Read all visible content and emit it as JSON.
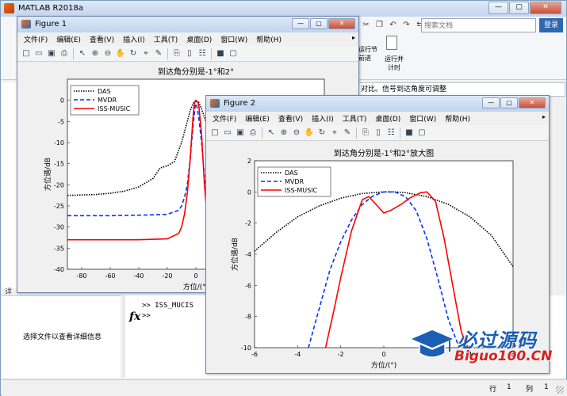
{
  "main": {
    "title": "MATLAB R2018a",
    "window_buttons": {
      "minimize": "—",
      "maximize": "▢",
      "close": "✕"
    },
    "search_placeholder": "搜索文档",
    "login_label": "登录",
    "ribbon": {
      "run_section": "运行节",
      "advance": "前进",
      "run_time": "运行并\n计时"
    },
    "address_text": "对比。信号到达角度可调整",
    "details_label": "详",
    "details_text": "选择文件以查看详细信息",
    "command_lines": [
      ">> ISS_MUCIS",
      ">>"
    ],
    "status": {
      "row_label": "行",
      "row_value": "1",
      "col_label": "列",
      "col_value": "1"
    }
  },
  "figures": [
    {
      "title": "Figure 1",
      "menu": [
        "文件(F)",
        "编辑(E)",
        "查看(V)",
        "插入(I)",
        "工具(T)",
        "桌面(D)",
        "窗口(W)",
        "帮助(H)"
      ],
      "chart_data": {
        "type": "line",
        "title": "到达角分别是-1°和2°",
        "xlabel": "方位/(°)",
        "ylabel": "方位谱/dB",
        "xlim": [
          -90,
          90
        ],
        "ylim": [
          -40,
          5
        ],
        "xticks": [
          -80,
          -60,
          -40,
          -20,
          0
        ],
        "yticks": [
          0,
          -5,
          -10,
          -15,
          -20,
          -25,
          -30,
          -35,
          -40
        ],
        "legend": "top-left",
        "series": [
          {
            "name": "DAS",
            "color": "#000000",
            "style": "dotted",
            "x": [
              -90,
              -70,
              -60,
              -50,
              -40,
              -35,
              -30,
              -25,
              -20,
              -15,
              -10,
              -8,
              -6,
              -4,
              -2,
              0,
              2,
              4,
              6,
              8,
              10,
              15
            ],
            "y": [
              -22.5,
              -22.3,
              -22,
              -21.5,
              -20.5,
              -19.5,
              -18.5,
              -16,
              -15.5,
              -14.5,
              -10,
              -7.5,
              -5,
              -2.5,
              -0.8,
              0,
              -0.5,
              -2,
              -4,
              -6,
              -8,
              -12
            ]
          },
          {
            "name": "MVDR",
            "color": "#0033ff",
            "style": "dashed",
            "x": [
              -90,
              -60,
              -40,
              -20,
              -12,
              -10,
              -8,
              -6,
              -4,
              -2,
              0,
              2,
              4,
              6,
              8,
              10
            ],
            "y": [
              -27.3,
              -27.3,
              -27.2,
              -27,
              -26,
              -25,
              -23,
              -20,
              -14,
              -6,
              0,
              -4,
              -10,
              -18,
              -24,
              -26
            ]
          },
          {
            "name": "ISS-MUSIC",
            "color": "#ff0000",
            "style": "solid",
            "x": [
              -90,
              -60,
              -40,
              -20,
              -12,
              -10,
              -8,
              -6,
              -4,
              -2,
              -1,
              0,
              1,
              2,
              4,
              6,
              8,
              10
            ],
            "y": [
              -33,
              -33,
              -33,
              -32.8,
              -31.5,
              -30,
              -27,
              -22,
              -14,
              -4,
              -0.5,
              0,
              -0.3,
              -1,
              -8,
              -20,
              -28,
              -32
            ]
          }
        ]
      }
    },
    {
      "title": "Figure 2",
      "menu": [
        "文件(F)",
        "编辑(E)",
        "查看(V)",
        "插入(I)",
        "工具(T)",
        "桌面(D)",
        "窗口(W)",
        "帮助(H)"
      ],
      "chart_data": {
        "type": "line",
        "title": "到达角分别是-1°和2°放大图",
        "xlabel": "方位/(°)",
        "ylabel": "方位谱/dB",
        "xlim": [
          -6,
          6
        ],
        "ylim": [
          -10,
          2
        ],
        "xticks": [
          -6,
          -4,
          -2,
          0,
          2,
          4,
          6
        ],
        "yticks": [
          2,
          0,
          -2,
          -4,
          -6,
          -8,
          -10
        ],
        "legend": "top-left",
        "series": [
          {
            "name": "DAS",
            "color": "#000000",
            "style": "dotted",
            "x": [
              -6,
              -5,
              -4,
              -3,
              -2,
              -1,
              0,
              0.5,
              1,
              2,
              3,
              4,
              5,
              6
            ],
            "y": [
              -3.8,
              -2.6,
              -1.6,
              -0.9,
              -0.4,
              -0.1,
              0,
              0,
              -0.05,
              -0.3,
              -0.8,
              -1.6,
              -2.8,
              -4.8
            ]
          },
          {
            "name": "MVDR",
            "color": "#0033ff",
            "style": "dashed",
            "x": [
              -3.5,
              -3,
              -2.5,
              -2,
              -1.5,
              -1,
              -0.5,
              0,
              0.5,
              1,
              1.5,
              2,
              2.5,
              3,
              3.5,
              4
            ],
            "y": [
              -10,
              -7.5,
              -5,
              -3.2,
              -1.8,
              -0.8,
              -0.25,
              0,
              0,
              -0.3,
              -1.2,
              -3,
              -5.5,
              -8.2,
              -10,
              -10
            ]
          },
          {
            "name": "ISS-MUSIC",
            "color": "#ff0000",
            "style": "solid",
            "x": [
              -2.7,
              -2.3,
              -2,
              -1.5,
              -1,
              -0.7,
              -0.3,
              0,
              0.3,
              0.8,
              1.2,
              1.7,
              2,
              2.4,
              2.8,
              3.2,
              3.6,
              3.9
            ],
            "y": [
              -10,
              -7.5,
              -5.5,
              -2.5,
              -0.5,
              -0.3,
              -0.9,
              -1.35,
              -1.2,
              -0.8,
              -0.4,
              -0.05,
              0,
              -0.6,
              -3,
              -6,
              -9,
              -10
            ]
          }
        ]
      }
    }
  ],
  "watermark": {
    "cn": "必过源码",
    "en": "Biguo100.CN"
  }
}
